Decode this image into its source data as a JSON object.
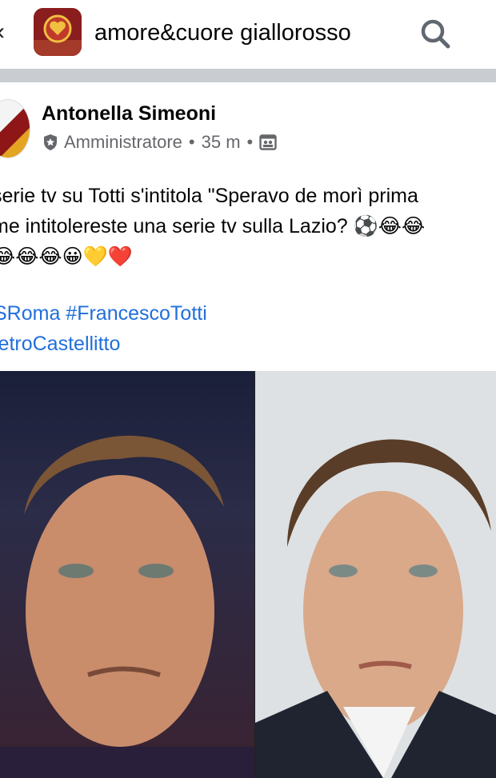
{
  "header": {
    "group_name": "amore&cuore giallorosso",
    "icons": [
      "back-arrow-icon",
      "search-icon"
    ]
  },
  "post": {
    "author": "Antonella Simeoni",
    "role": "Amministratore",
    "time": "35 m",
    "separator": "•",
    "audience_icon": "group-audience-icon",
    "text_lines": [
      "serie tv su Totti s'intitola \"Speravo de morì prima",
      "me intitolereste una serie tv sulla Lazio? ⚽😂😂",
      "😂😂😂😀💛❤️"
    ],
    "hashtags": [
      "SRoma #FrancescoTotti",
      "ietroCastellitto"
    ]
  },
  "colors": {
    "divider": "#c9ccd1",
    "hashtag": "#216fdb",
    "meta": "#65676b"
  }
}
